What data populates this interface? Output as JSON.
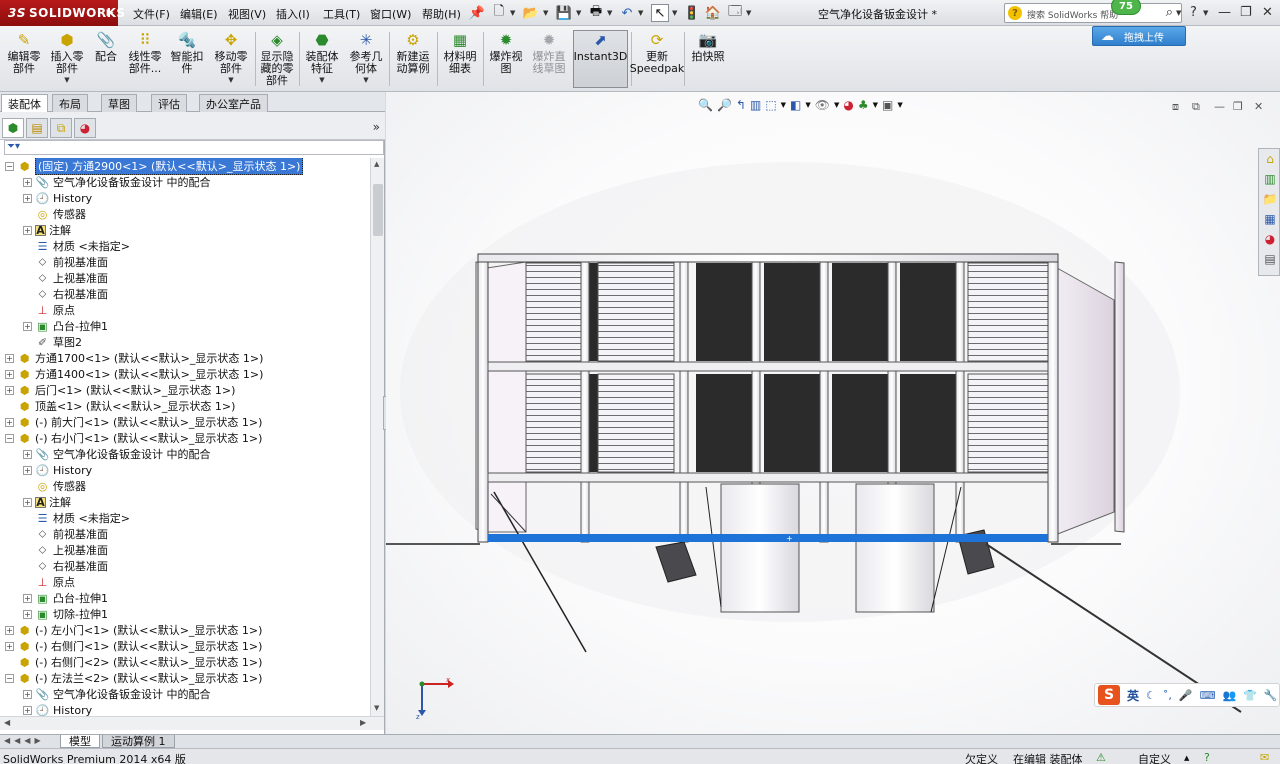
{
  "app": {
    "logo_prefix": "3S",
    "logo_text": "SOLIDWORKS",
    "document_title": "空气净化设备钣金设计 *",
    "product_version": "SolidWorks Premium 2014 x64 版"
  },
  "menu": [
    "文件(F)",
    "编辑(E)",
    "视图(V)",
    "插入(I)",
    "工具(T)",
    "窗口(W)",
    "帮助(H)"
  ],
  "search": {
    "placeholder": "搜索 SolidWorks 帮助"
  },
  "badge": {
    "value": "75"
  },
  "upload": {
    "label": "拖拽上传"
  },
  "ribbon": {
    "buttons": [
      {
        "label": "编辑零\n部件"
      },
      {
        "label": "插入零\n部件"
      },
      {
        "label": "配合"
      },
      {
        "label": "线性零\n部件..."
      },
      {
        "label": "智能扣\n件"
      },
      {
        "label": "移动零\n部件"
      },
      {
        "label": "显示隐\n藏的零\n部件"
      },
      {
        "label": "装配体\n特征"
      },
      {
        "label": "参考几\n何体"
      },
      {
        "label": "新建运\n动算例"
      },
      {
        "label": "材料明\n细表"
      },
      {
        "label": "爆炸视\n图"
      },
      {
        "label": "爆炸直\n线草图"
      },
      {
        "label": "Instant3D"
      },
      {
        "label": "更新\nSpeedpak"
      },
      {
        "label": "拍快照"
      }
    ]
  },
  "command_tabs": [
    "装配体",
    "布局",
    "草图",
    "评估",
    "办公室产品"
  ],
  "tree": [
    {
      "text": "(固定) 方通2900<1> (默认<<默认>_显示状态 1>)",
      "indent": 0,
      "expander": "-",
      "icon": "asm",
      "selected": true
    },
    {
      "text": "空气净化设备钣金设计 中的配合",
      "indent": 1,
      "expander": "+",
      "icon": "mate"
    },
    {
      "text": "History",
      "indent": 1,
      "expander": "+",
      "icon": "hist"
    },
    {
      "text": "传感器",
      "indent": 1,
      "expander": "",
      "icon": "sens"
    },
    {
      "text": "注解",
      "indent": 1,
      "expander": "+",
      "icon": "note"
    },
    {
      "text": "材质 <未指定>",
      "indent": 1,
      "expander": "",
      "icon": "mat"
    },
    {
      "text": "前视基准面",
      "indent": 1,
      "expander": "",
      "icon": "plane"
    },
    {
      "text": "上视基准面",
      "indent": 1,
      "expander": "",
      "icon": "plane"
    },
    {
      "text": "右视基准面",
      "indent": 1,
      "expander": "",
      "icon": "plane"
    },
    {
      "text": "原点",
      "indent": 1,
      "expander": "",
      "icon": "origin"
    },
    {
      "text": "凸台-拉伸1",
      "indent": 1,
      "expander": "+",
      "icon": "feat"
    },
    {
      "text": "草图2",
      "indent": 1,
      "expander": "",
      "icon": "sketch"
    },
    {
      "text": "方通1700<1> (默认<<默认>_显示状态 1>)",
      "indent": 0,
      "expander": "+",
      "icon": "asm"
    },
    {
      "text": "方通1400<1> (默认<<默认>_显示状态 1>)",
      "indent": 0,
      "expander": "+",
      "icon": "asm"
    },
    {
      "text": "后门<1> (默认<<默认>_显示状态 1>)",
      "indent": 0,
      "expander": "+",
      "icon": "asm"
    },
    {
      "text": "顶盖<1> (默认<<默认>_显示状态 1>)",
      "indent": 0,
      "expander": "",
      "icon": "asm"
    },
    {
      "text": "(-) 前大门<1> (默认<<默认>_显示状态 1>)",
      "indent": 0,
      "expander": "+",
      "icon": "asm"
    },
    {
      "text": "(-) 右小门<1> (默认<<默认>_显示状态 1>)",
      "indent": 0,
      "expander": "-",
      "icon": "asm"
    },
    {
      "text": "空气净化设备钣金设计 中的配合",
      "indent": 1,
      "expander": "+",
      "icon": "mate"
    },
    {
      "text": "History",
      "indent": 1,
      "expander": "+",
      "icon": "hist"
    },
    {
      "text": "传感器",
      "indent": 1,
      "expander": "",
      "icon": "sens"
    },
    {
      "text": "注解",
      "indent": 1,
      "expander": "+",
      "icon": "note"
    },
    {
      "text": "材质 <未指定>",
      "indent": 1,
      "expander": "",
      "icon": "mat"
    },
    {
      "text": "前视基准面",
      "indent": 1,
      "expander": "",
      "icon": "plane"
    },
    {
      "text": "上视基准面",
      "indent": 1,
      "expander": "",
      "icon": "plane"
    },
    {
      "text": "右视基准面",
      "indent": 1,
      "expander": "",
      "icon": "plane"
    },
    {
      "text": "原点",
      "indent": 1,
      "expander": "",
      "icon": "origin"
    },
    {
      "text": "凸台-拉伸1",
      "indent": 1,
      "expander": "+",
      "icon": "feat"
    },
    {
      "text": "切除-拉伸1",
      "indent": 1,
      "expander": "+",
      "icon": "feat"
    },
    {
      "text": "(-) 左小门<1> (默认<<默认>_显示状态 1>)",
      "indent": 0,
      "expander": "+",
      "icon": "asm"
    },
    {
      "text": "(-) 右侧门<1> (默认<<默认>_显示状态 1>)",
      "indent": 0,
      "expander": "+",
      "icon": "asm"
    },
    {
      "text": "(-) 右侧门<2> (默认<<默认>_显示状态 1>)",
      "indent": 0,
      "expander": "",
      "icon": "asm"
    },
    {
      "text": "(-) 左法兰<2> (默认<<默认>_显示状态 1>)",
      "indent": 0,
      "expander": "-",
      "icon": "asm"
    },
    {
      "text": "空气净化设备钣金设计 中的配合",
      "indent": 1,
      "expander": "+",
      "icon": "mate"
    },
    {
      "text": "History",
      "indent": 1,
      "expander": "+",
      "icon": "hist"
    }
  ],
  "bottom_tabs": [
    "模型",
    "运动算例 1"
  ],
  "status": {
    "under_defined": "欠定义",
    "editing": "在编辑 装配体",
    "custom": "自定义"
  },
  "ime": {
    "language": "英"
  },
  "triad": {
    "x": "x",
    "y": "y",
    "z": "z"
  },
  "colors": {
    "logo": "#a51414",
    "selection": "#3a78d6",
    "highlight_edge": "#1e73d8",
    "panel_fill": "#2b2b2b"
  }
}
